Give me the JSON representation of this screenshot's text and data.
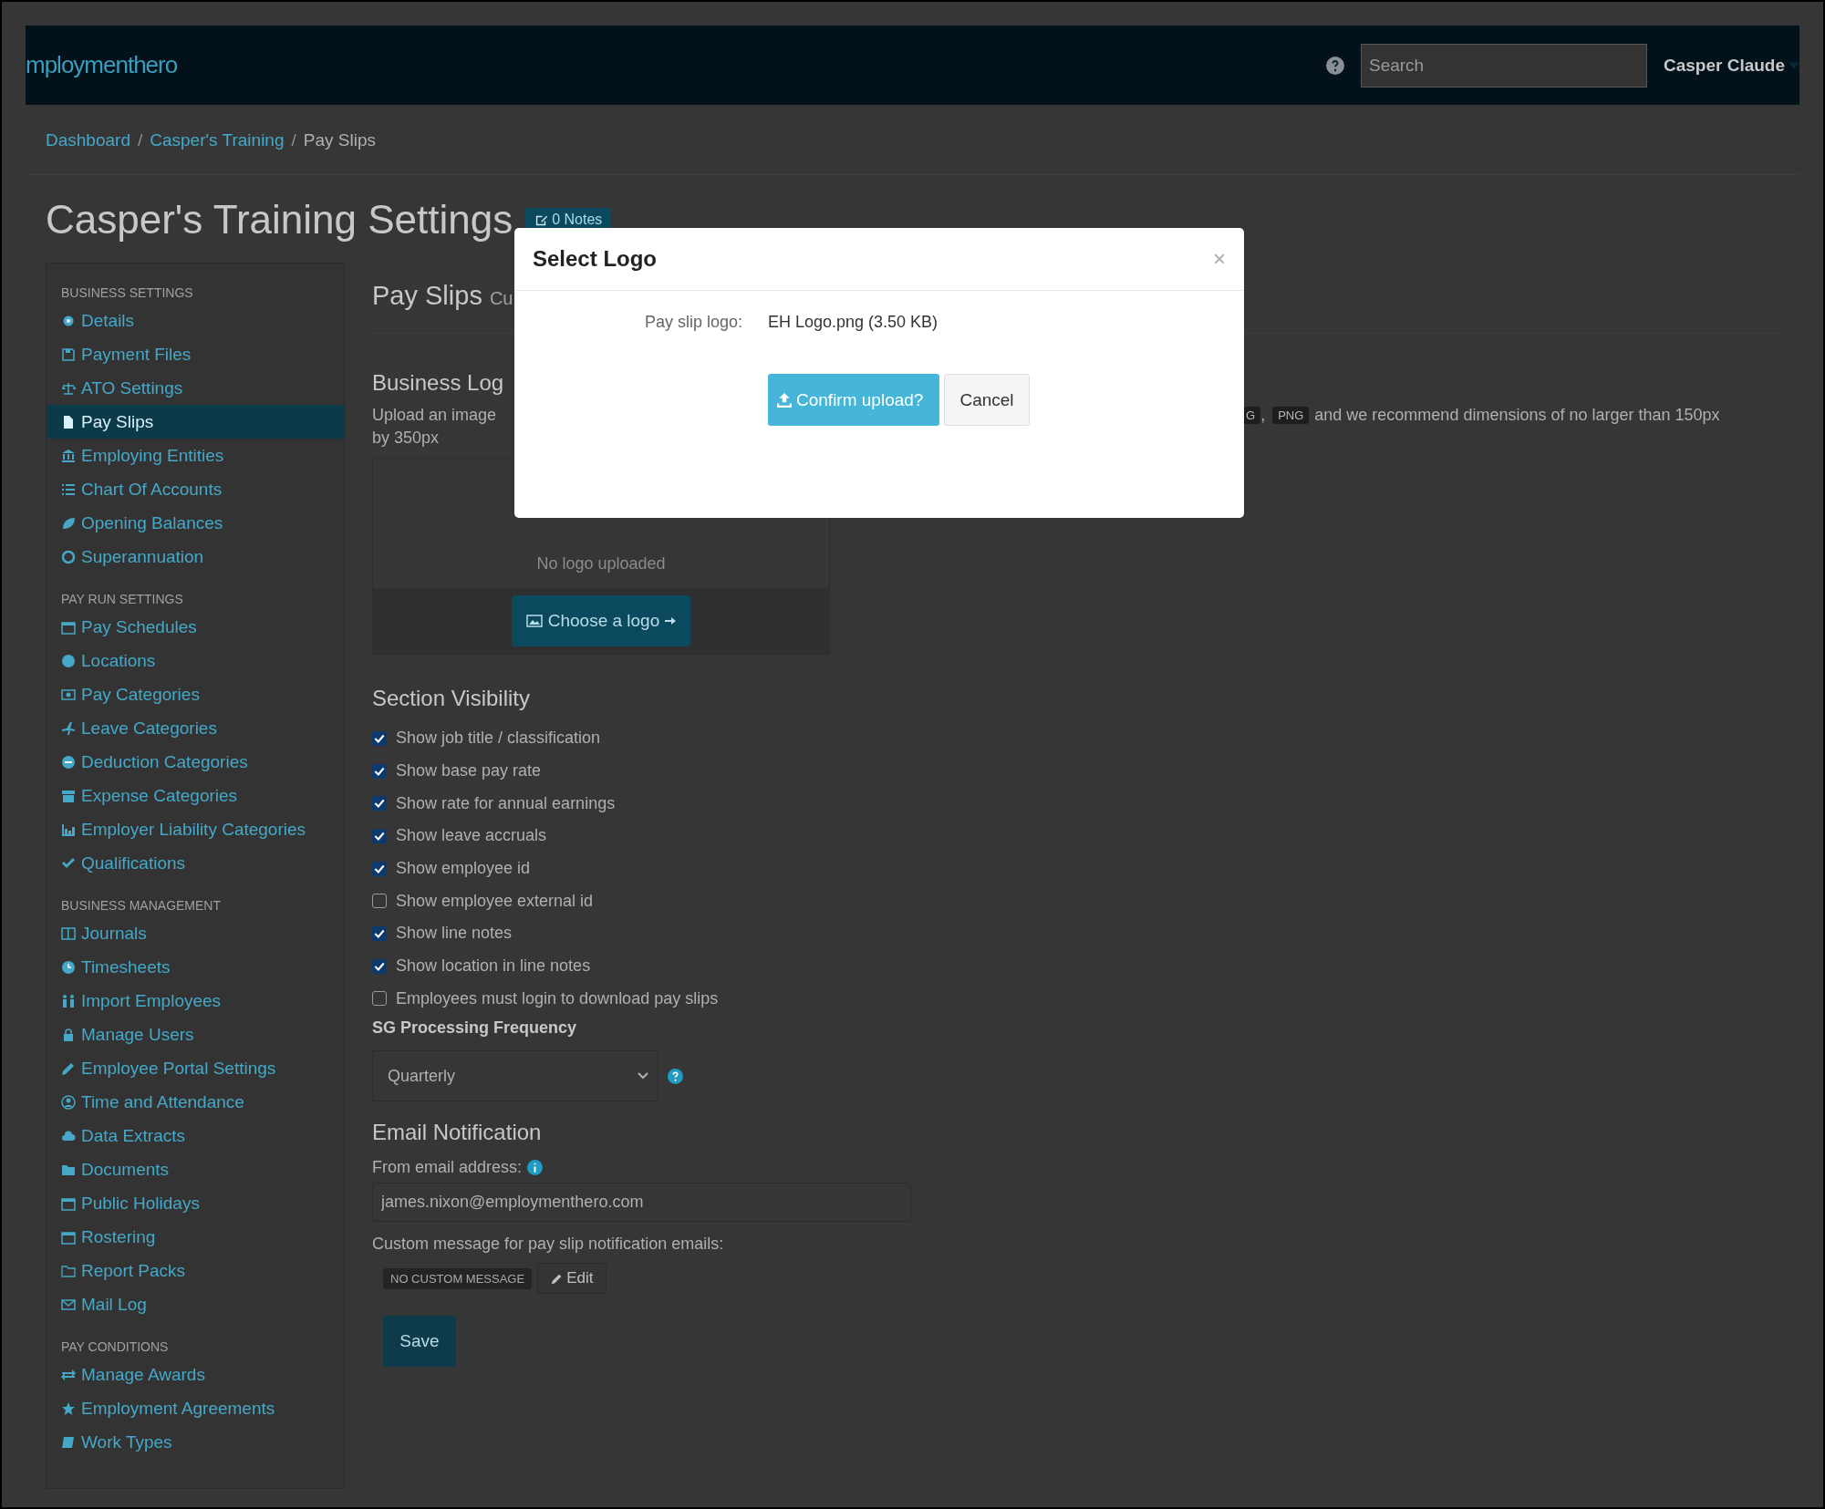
{
  "navbar": {
    "logo": "mploymenthero",
    "search": {
      "placeholder": "Search"
    },
    "user": "Casper Claude"
  },
  "breadcrumb": {
    "separator": "/",
    "items": [
      {
        "label": "Dashboard",
        "kind": "link"
      },
      {
        "label": "Casper's Training",
        "kind": "link"
      },
      {
        "label": "Pay Slips",
        "kind": "current"
      }
    ]
  },
  "page_title": "Casper's Training Settings",
  "notes_button": "0 Notes",
  "sidebar": {
    "groups": [
      {
        "heading": "BUSINESS SETTINGS",
        "items": [
          {
            "label": "Details",
            "selected": false
          },
          {
            "label": "Payment Files",
            "selected": false
          },
          {
            "label": "ATO Settings",
            "selected": false
          },
          {
            "label": "Pay Slips",
            "selected": true
          },
          {
            "label": "Employing Entities",
            "selected": false
          },
          {
            "label": "Chart Of Accounts",
            "selected": false
          },
          {
            "label": "Opening Balances",
            "selected": false
          },
          {
            "label": "Superannuation",
            "selected": false
          }
        ]
      },
      {
        "heading": "PAY RUN SETTINGS",
        "items": [
          {
            "label": "Pay Schedules",
            "selected": false
          },
          {
            "label": "Locations",
            "selected": false
          },
          {
            "label": "Pay Categories",
            "selected": false
          },
          {
            "label": "Leave Categories",
            "selected": false
          },
          {
            "label": "Deduction Categories",
            "selected": false
          },
          {
            "label": "Expense Categories",
            "selected": false
          },
          {
            "label": "Employer Liability Categories",
            "selected": false
          },
          {
            "label": "Qualifications",
            "selected": false
          }
        ]
      },
      {
        "heading": "BUSINESS MANAGEMENT",
        "items": [
          {
            "label": "Journals",
            "selected": false
          },
          {
            "label": "Timesheets",
            "selected": false
          },
          {
            "label": "Import Employees",
            "selected": false
          },
          {
            "label": "Manage Users",
            "selected": false
          },
          {
            "label": "Employee Portal Settings",
            "selected": false
          },
          {
            "label": "Time and Attendance",
            "selected": false
          },
          {
            "label": "Data Extracts",
            "selected": false
          },
          {
            "label": "Documents",
            "selected": false
          },
          {
            "label": "Public Holidays",
            "selected": false
          },
          {
            "label": "Rostering",
            "selected": false
          },
          {
            "label": "Report Packs",
            "selected": false
          },
          {
            "label": "Mail Log",
            "selected": false
          }
        ]
      },
      {
        "heading": "PAY CONDITIONS",
        "items": [
          {
            "label": "Manage Awards",
            "selected": false
          },
          {
            "label": "Employment Agreements",
            "selected": false
          },
          {
            "label": "Work Types",
            "selected": false
          }
        ]
      }
    ]
  },
  "content": {
    "heading": "Pay Slips",
    "subheading": "Cu",
    "business_logo": {
      "heading": "Business Log",
      "description_start": "Upload an image",
      "format_badges": [
        "G",
        "PNG"
      ],
      "badge_separator": ",",
      "description_end": "and we recommend dimensions of no larger than 150px",
      "description_line2": "by 350px",
      "empty_text": "No logo uploaded",
      "choose_button": "Choose a logo"
    },
    "section_visibility": {
      "heading": "Section Visibility",
      "options": [
        {
          "label": "Show job title / classification",
          "checked": true
        },
        {
          "label": "Show base pay rate",
          "checked": true
        },
        {
          "label": "Show rate for annual earnings",
          "checked": true
        },
        {
          "label": "Show leave accruals",
          "checked": true
        },
        {
          "label": "Show employee id",
          "checked": true
        },
        {
          "label": "Show employee external id",
          "checked": false
        },
        {
          "label": "Show line notes",
          "checked": true
        },
        {
          "label": "Show location in line notes",
          "checked": true
        },
        {
          "label": "Employees must login to download pay slips",
          "checked": false
        }
      ]
    },
    "sg_frequency": {
      "label": "SG Processing Frequency",
      "value": "Quarterly"
    },
    "email": {
      "heading": "Email Notification",
      "from_label": "From email address:",
      "from_value": "james.nixon@employmenthero.com",
      "custom_label": "Custom message for pay slip notification emails:",
      "custom_badge": "NO CUSTOM MESSAGE",
      "edit_button": "Edit"
    },
    "save_button": "Save"
  },
  "modal": {
    "title": "Select Logo",
    "close": "×",
    "field_label": "Pay slip logo:",
    "field_value": "EH Logo.png (3.50 KB)",
    "confirm_button": "Confirm upload?",
    "cancel_button": "Cancel"
  }
}
